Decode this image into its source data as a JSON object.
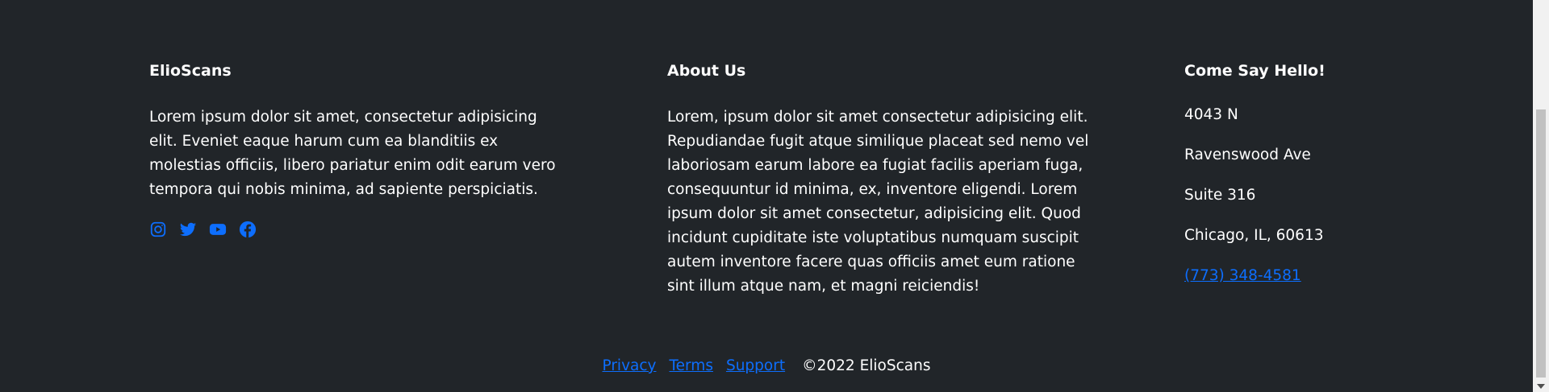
{
  "brand": {
    "heading": "ElioScans",
    "text": "Lorem ipsum dolor sit amet, consectetur adipisicing elit. Eveniet eaque harum cum ea blanditiis ex molestias officiis, libero pariatur enim odit earum vero tempora qui nobis minima, ad sapiente perspiciatis.",
    "social_icons": [
      "instagram-icon",
      "twitter-icon",
      "youtube-icon",
      "facebook-icon"
    ],
    "icon_color": "#0d6efd"
  },
  "about": {
    "heading": "About Us",
    "text": "Lorem, ipsum dolor sit amet consectetur adipisicing elit. Repudiandae fugit atque similique placeat sed nemo vel laboriosam earum labore ea fugiat facilis aperiam fuga, consequuntur id minima, ex, inventore eligendi. Lorem ipsum dolor sit amet consectetur, adipisicing elit. Quod incidunt cupiditate iste voluptatibus numquam suscipit autem inventore facere quas officiis amet eum ratione sint illum atque nam, et magni reiciendis!"
  },
  "contact": {
    "heading": "Come Say Hello!",
    "address": [
      "4043 N",
      "Ravenswood Ave",
      "Suite 316",
      "Chicago, IL, 60613"
    ],
    "phone": "(773) 348-4581"
  },
  "bottom": {
    "links": [
      "Privacy",
      "Terms",
      "Support"
    ],
    "copyright": "©2022 ElioScans"
  },
  "colors": {
    "background": "#212529",
    "link": "#0d6efd",
    "text": "#ffffff"
  }
}
